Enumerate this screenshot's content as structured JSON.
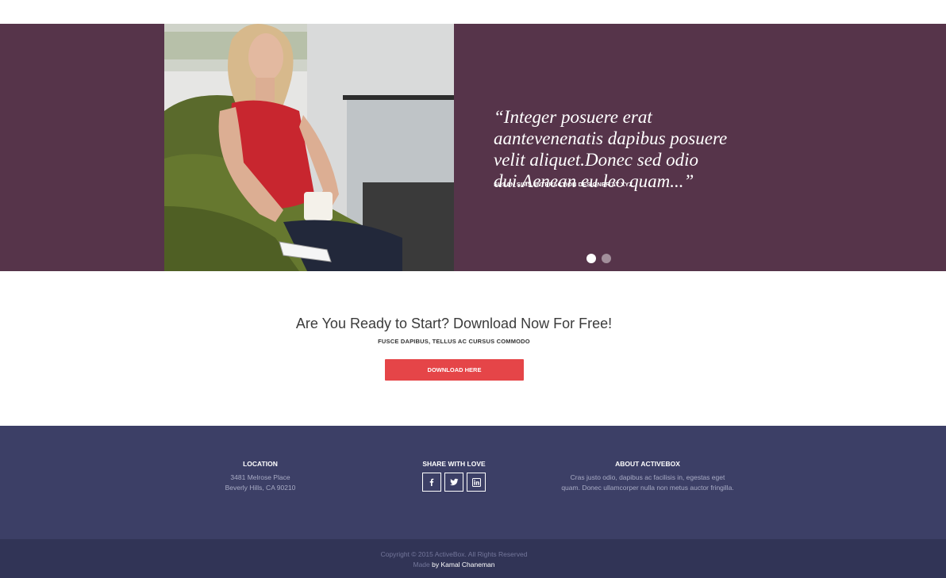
{
  "testimonial": {
    "quote": "“Integer posuere erat aantevenenatis dapibus posuere velit aliquet.Donec sed odio dui.Aenean eu leo quam...”",
    "author": "SUSAN SIMS, INTERACTION DESIGNER AT XYZ",
    "background_color": "#56344a",
    "slides": [
      {
        "active": true
      },
      {
        "active": false
      }
    ]
  },
  "cta": {
    "title": "Are You Ready to Start? Download Now For Free!",
    "subtitle": "FUSCE DAPIBUS, TELLUS AC CURSUS COMMODO",
    "button_label": "DOWNLOAD HERE",
    "button_color": "#e54548"
  },
  "footer": {
    "background_color": "#3c3f66",
    "location": {
      "heading": "LOCATION",
      "line1": "3481 Melrose Place",
      "line2": "Beverly Hills, CA 90210"
    },
    "share": {
      "heading": "SHARE WITH LOVE",
      "icons": [
        "facebook-icon",
        "twitter-icon",
        "linkedin-icon"
      ]
    },
    "about": {
      "heading": "ABOUT ACTIVEBOX",
      "text": "Cras justo odio, dapibus ac facilisis in, egestas eget quam. Donec ullamcorper nulla non metus auctor fringilla."
    },
    "copyright": "Copyright © 2015 ActiveBox. All Rights Reserved",
    "made_prefix": "Made",
    "made_by": "by Kamal Chaneman"
  }
}
